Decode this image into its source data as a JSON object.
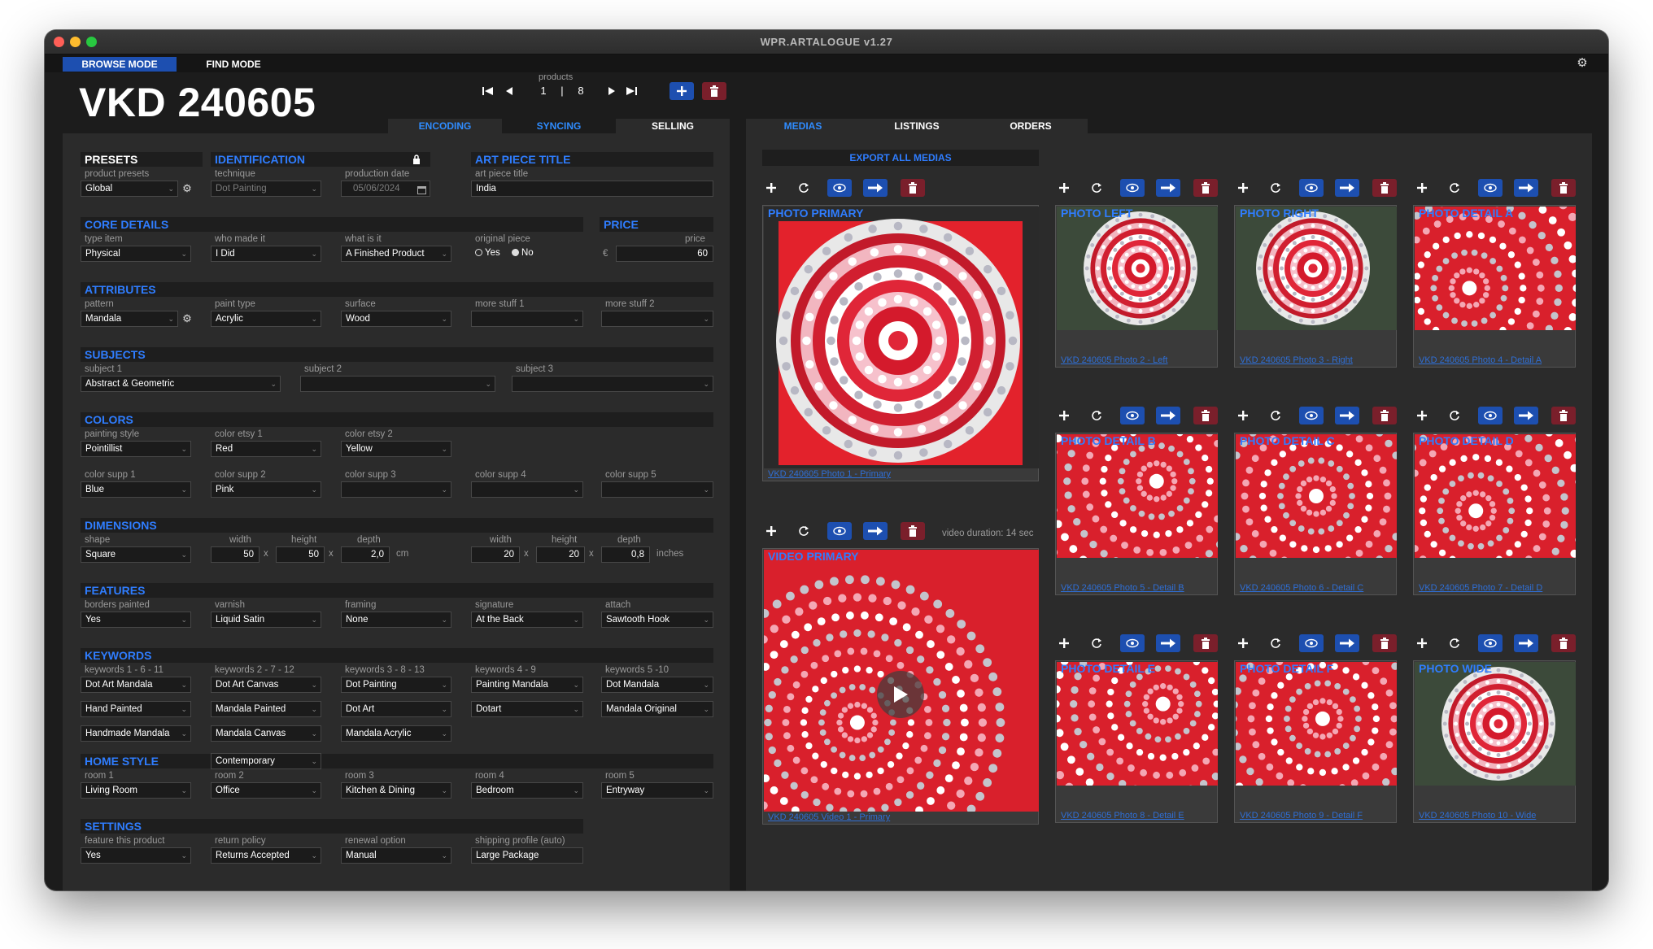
{
  "window": {
    "title": "WPR.ARTALOGUE v1.27"
  },
  "modes": {
    "browse": "BROWSE MODE",
    "find": "FIND MODE"
  },
  "record": {
    "title": "VKD 240605"
  },
  "nav": {
    "label": "products",
    "current": "1",
    "separator": "|",
    "total": "8"
  },
  "left_tabs": [
    "ENCODING",
    "SYNCING",
    "SELLING"
  ],
  "right_tabs": [
    "MEDIAS",
    "LISTINGS",
    "ORDERS"
  ],
  "presets": {
    "heading": "PRESETS",
    "label": "product presets",
    "value": "Global"
  },
  "identification": {
    "heading": "IDENTIFICATION",
    "technique_label": "technique",
    "technique": "Dot Painting",
    "date_label": "production date",
    "date": "05/06/2024"
  },
  "art_title": {
    "heading": "ART PIECE TITLE",
    "label": "art piece title",
    "value": "India"
  },
  "core": {
    "heading": "CORE DETAILS",
    "type_label": "type item",
    "type": "Physical",
    "who_label": "who made it",
    "who": "I Did",
    "what_label": "what is it",
    "what": "A Finished Product",
    "orig_label": "original piece",
    "yes": "Yes",
    "no": "No"
  },
  "price": {
    "heading": "PRICE",
    "label": "price",
    "currency": "€",
    "value": "60"
  },
  "attributes": {
    "heading": "ATTRIBUTES",
    "pattern_label": "pattern",
    "pattern": "Mandala",
    "paint_label": "paint type",
    "paint": "Acrylic",
    "surface_label": "surface",
    "surface": "Wood",
    "more1_label": "more stuff 1",
    "more1": "",
    "more2_label": "more stuff 2",
    "more2": ""
  },
  "subjects": {
    "heading": "SUBJECTS",
    "s1_label": "subject 1",
    "s1": "Abstract & Geometric",
    "s2_label": "subject 2",
    "s2": "",
    "s3_label": "subject 3",
    "s3": ""
  },
  "colors": {
    "heading": "COLORS",
    "style_label": "painting style",
    "style": "Pointillist",
    "etsy1_label": "color etsy 1",
    "etsy1": "Red",
    "etsy2_label": "color etsy 2",
    "etsy2": "Yellow",
    "supp1_label": "color supp 1",
    "supp1": "Blue",
    "supp2_label": "color supp 2",
    "supp2": "Pink",
    "supp3_label": "color supp 3",
    "supp3": "",
    "supp4_label": "color supp 4",
    "supp4": "",
    "supp5_label": "color supp 5",
    "supp5": ""
  },
  "dimensions": {
    "heading": "DIMENSIONS",
    "shape_label": "shape",
    "shape": "Square",
    "width_label": "width",
    "height_label": "height",
    "depth_label": "depth",
    "cm_w": "50",
    "cm_h": "50",
    "cm_d": "2,0",
    "cm_unit": "cm",
    "in_w": "20",
    "in_h": "20",
    "in_d": "0,8",
    "in_unit": "inches",
    "x": "x"
  },
  "features": {
    "heading": "FEATURES",
    "borders_label": "borders painted",
    "borders": "Yes",
    "varnish_label": "varnish",
    "varnish": "Liquid Satin",
    "framing_label": "framing",
    "framing": "None",
    "signature_label": "signature",
    "signature": "At the Back",
    "attach_label": "attach",
    "attach": "Sawtooth Hook"
  },
  "keywords": {
    "heading": "KEYWORDS",
    "labels": [
      "keywords 1 - 6 - 11",
      "keywords 2 - 7 - 12",
      "keywords 3 - 8 - 13",
      "keywords 4 - 9",
      "keywords 5 -10"
    ],
    "row1": [
      "Dot Art Mandala",
      "Dot Art Canvas",
      "Dot Painting",
      "Painting Mandala",
      "Dot Mandala"
    ],
    "row2": [
      "Hand Painted",
      "Mandala Painted",
      "Dot Art",
      "Dotart",
      "Mandala Original"
    ],
    "row3": [
      "Handmade Mandala",
      "Mandala Canvas",
      "Mandala Acrylic"
    ]
  },
  "home": {
    "heading": "HOME STYLE",
    "style": "Contemporary",
    "labels": [
      "room 1",
      "room 2",
      "room 3",
      "room 4",
      "room 5"
    ],
    "rooms": [
      "Living Room",
      "Office",
      "Kitchen & Dining",
      "Bedroom",
      "Entryway"
    ]
  },
  "settings": {
    "heading": "SETTINGS",
    "feature_label": "feature this product",
    "feature": "Yes",
    "return_label": "return policy",
    "return": "Returns Accepted",
    "renewal_label": "renewal option",
    "renewal": "Manual",
    "shipping_label": "shipping profile (auto)",
    "shipping": "Large Package"
  },
  "medias": {
    "export": "EXPORT ALL MEDIAS",
    "video_duration": "video duration: 14 sec",
    "primary": {
      "title": "PHOTO PRIMARY",
      "caption": "VKD 240605 Photo 1 - Primary"
    },
    "video": {
      "title": "VIDEO PRIMARY",
      "caption": "VKD 240605 Video 1 - Primary"
    },
    "cards": [
      {
        "title": "PHOTO LEFT",
        "caption": "VKD 240605 Photo 2 - Left"
      },
      {
        "title": "PHOTO RIGHT",
        "caption": "VKD 240605 Photo 3 - Right"
      },
      {
        "title": "PHOTO DETAIL A",
        "caption": "VKD 240605 Photo 4 - Detail A"
      },
      {
        "title": "PHOTO DETAIL B",
        "caption": "VKD 240605 Photo 5 - Detail B"
      },
      {
        "title": "PHOTO DETAIL C",
        "caption": "VKD 240605 Photo 6 - Detail C"
      },
      {
        "title": "PHOTO DETAIL D",
        "caption": "VKD 240605 Photo 7 - Detail D"
      },
      {
        "title": "PHOTO DETAIL E",
        "caption": "VKD 240605 Photo 8 - Detail E"
      },
      {
        "title": "PHOTO DETAIL F",
        "caption": "VKD 240605 Photo 9 - Detail F"
      },
      {
        "title": "PHOTO WIDE",
        "caption": "VKD 240605 Photo 10 - Wide"
      }
    ]
  },
  "icons": [
    "first-record-icon",
    "previous-record-icon",
    "next-record-icon",
    "last-record-icon",
    "plus-icon",
    "trash-icon",
    "refresh-icon",
    "eye-icon",
    "arrow-right-icon",
    "gear-icon",
    "lock-icon",
    "calendar-icon",
    "play-icon"
  ],
  "colors_ui": {
    "accent": "#2f7dff",
    "button_blue": "#1d4fb0",
    "button_red": "#7a1f2b",
    "panel": "#2b2b2b",
    "window": "#1c1c1c"
  }
}
